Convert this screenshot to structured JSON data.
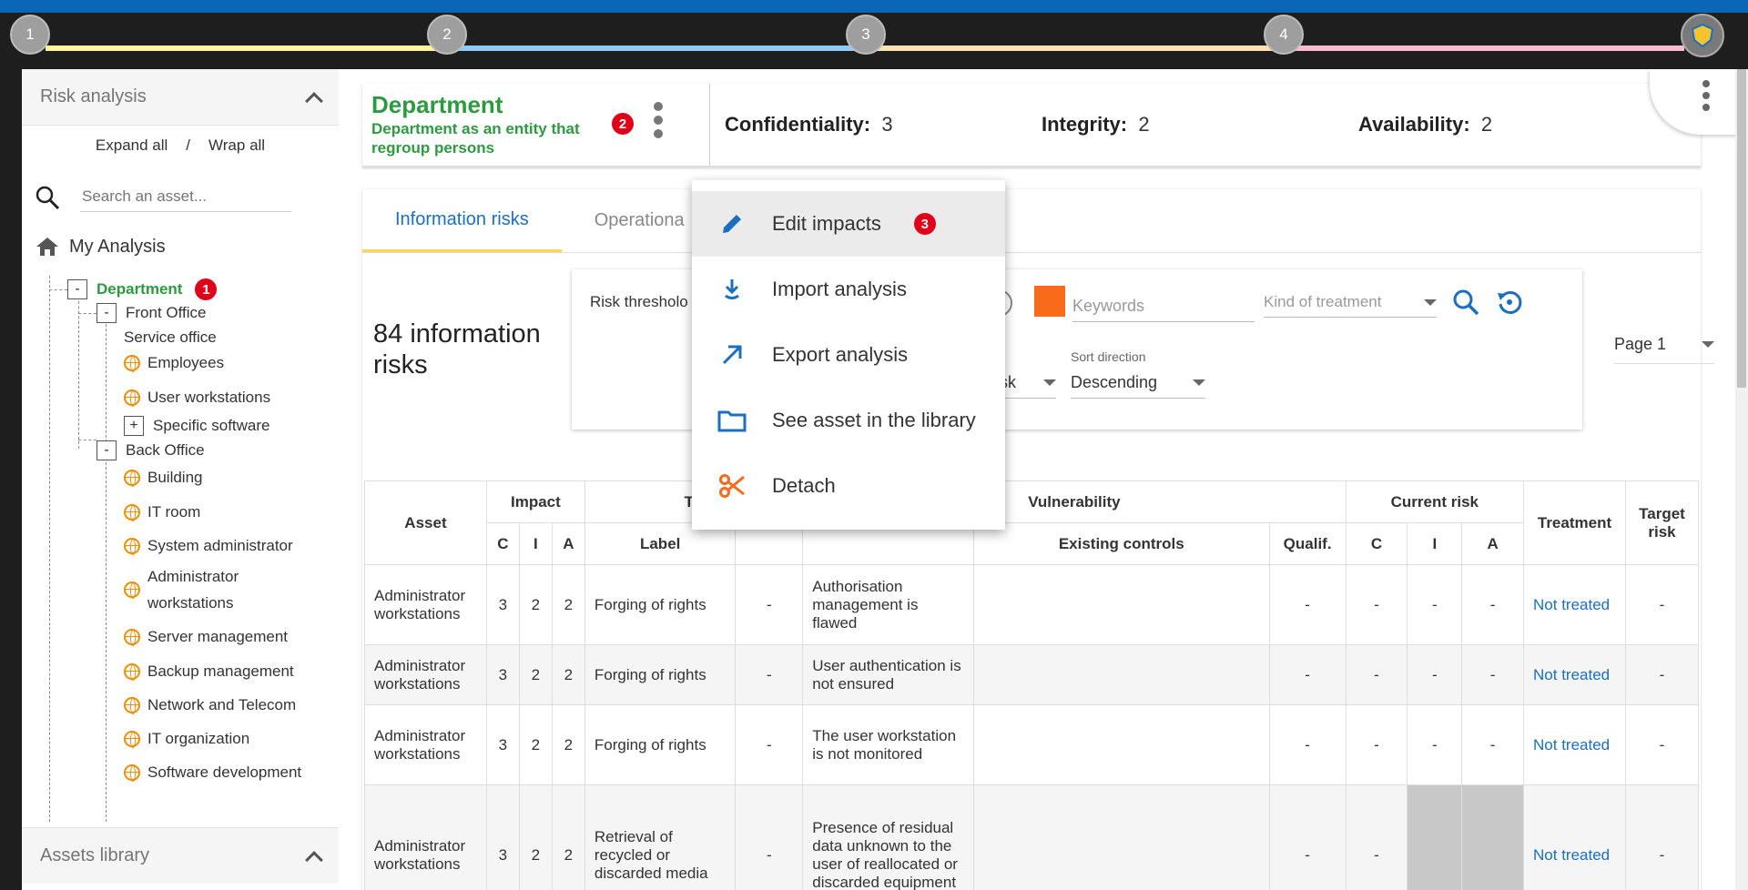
{
  "stepper": {
    "steps": [
      "1",
      "2",
      "3",
      "4"
    ],
    "colors": [
      "#fff59d",
      "#90caf9",
      "#ffe0b2",
      "#f8bbd0"
    ]
  },
  "sidebar": {
    "title": "Risk analysis",
    "expand_all": "Expand all",
    "separator": "/",
    "wrap_all": "Wrap all",
    "search_placeholder": "Search an asset...",
    "root": "My Analysis",
    "tree": {
      "department": "Department",
      "department_badge": "1",
      "front_office": "Front Office",
      "service_office": "Service office",
      "employees": "Employees",
      "user_workstations": "User workstations",
      "specific_software": "Specific software",
      "back_office": "Back Office",
      "building": "Building",
      "it_room": "IT room",
      "system_administrator": "System administrator",
      "administrator_workstations_1": "Administrator",
      "administrator_workstations_2": "workstations",
      "server_management": "Server management",
      "backup_management": "Backup management",
      "network_telecom": "Network and Telecom",
      "it_organization": "IT organization",
      "software_development": "Software development"
    },
    "footer": "Assets library"
  },
  "header": {
    "title": "Department",
    "subtitle": "Department as an entity that regroup persons",
    "badge": "2",
    "confidentiality_label": "Confidentiality:",
    "confidentiality_value": "3",
    "integrity_label": "Integrity:",
    "integrity_value": "2",
    "availability_label": "Availability:",
    "availability_value": "2"
  },
  "tabs": [
    "Information risks",
    "Operationa"
  ],
  "risk_count": "84 information risks",
  "filters": {
    "risk_threshold": "Risk thresholo",
    "keywords_placeholder": "Keywords",
    "kind_of_treatment": "Kind of treatment",
    "order_by_value": "sk",
    "sort_direction_label": "Sort direction",
    "sort_direction_value": "Descending",
    "page": "Page 1",
    "threshold_color": "#f96a1b"
  },
  "menu": {
    "items": [
      "Edit impacts",
      "Import analysis",
      "Export analysis",
      "See asset in the library",
      "Detach"
    ],
    "badge": "3"
  },
  "table": {
    "headers": {
      "asset": "Asset",
      "impact": "Impact",
      "threat": "Th",
      "vulnerability": "Vulnerability",
      "current_risk": "Current risk",
      "treatment": "Treatment",
      "target_risk": "Target risk",
      "c": "C",
      "i": "I",
      "a": "A",
      "label": "Label",
      "existing_controls": "Existing controls",
      "qualif": "Qualif."
    },
    "rows": [
      {
        "asset": "Administrator workstations",
        "c": "3",
        "i": "2",
        "a": "2",
        "threat": "Forging of rights",
        "prob": "-",
        "vuln": "Authorisation management is flawed",
        "controls": "",
        "qualif": "-",
        "rc": "-",
        "ri": "-",
        "ra": "-",
        "treatment": "Not treated",
        "target": "-"
      },
      {
        "asset": "Administrator workstations",
        "c": "3",
        "i": "2",
        "a": "2",
        "threat": "Forging of rights",
        "prob": "-",
        "vuln": "User authentication is not ensured",
        "controls": "",
        "qualif": "-",
        "rc": "-",
        "ri": "-",
        "ra": "-",
        "treatment": "Not treated",
        "target": "-"
      },
      {
        "asset": "Administrator workstations",
        "c": "3",
        "i": "2",
        "a": "2",
        "threat": "Forging of rights",
        "prob": "-",
        "vuln": "The user workstation is not monitored",
        "controls": "",
        "qualif": "-",
        "rc": "-",
        "ri": "-",
        "ra": "-",
        "treatment": "Not treated",
        "target": "-"
      },
      {
        "asset": "Administrator workstations",
        "c": "3",
        "i": "2",
        "a": "2",
        "threat": "Retrieval of recycled or discarded media",
        "prob": "-",
        "vuln": "Presence of residual data unknown to the user of reallocated or discarded equipment",
        "controls": "",
        "qualif": "-",
        "rc": "-",
        "ri": "",
        "ra": "",
        "treatment": "Not treated",
        "target": "-"
      }
    ]
  }
}
